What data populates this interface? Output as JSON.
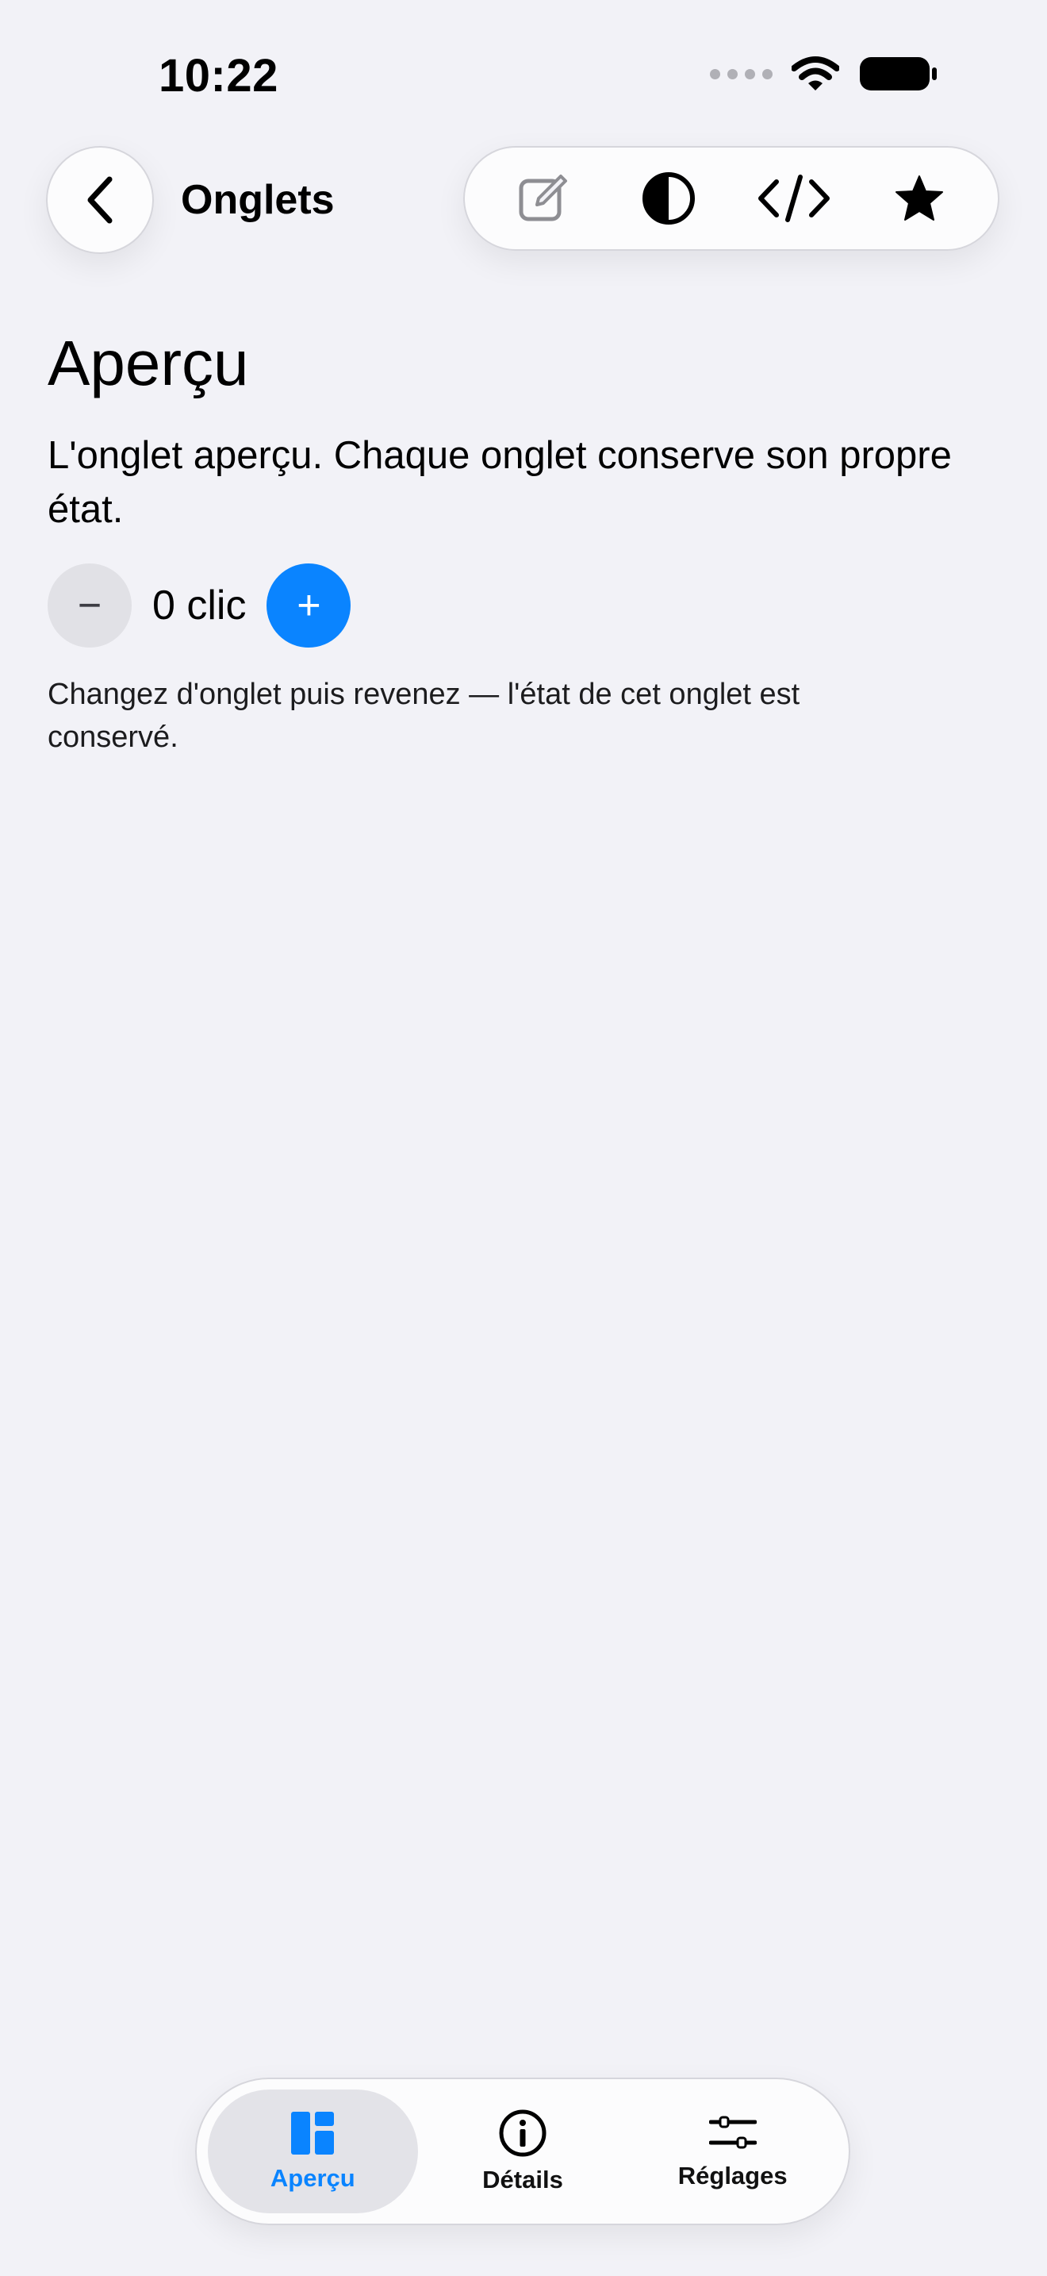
{
  "status": {
    "time": "10:22"
  },
  "nav": {
    "title": "Onglets"
  },
  "content": {
    "title": "Aperçu",
    "description": "L'onglet aperçu. Chaque onglet conserve son propre état.",
    "minus_label": "−",
    "count_label": "0 clic",
    "plus_label": "+",
    "hint": "Changez d'onglet puis revenez — l'état de cet onglet est conservé."
  },
  "tabs": [
    {
      "label": "Aperçu",
      "active": true
    },
    {
      "label": "Détails",
      "active": false
    },
    {
      "label": "Réglages",
      "active": false
    }
  ],
  "colors": {
    "accent": "#0a84ff",
    "background": "#f2f2f7"
  },
  "icons": {
    "toolbar": [
      "edit-icon",
      "contrast-icon",
      "code-icon",
      "star-icon"
    ],
    "tabs": [
      "layout-icon",
      "info-icon",
      "sliders-icon"
    ]
  }
}
